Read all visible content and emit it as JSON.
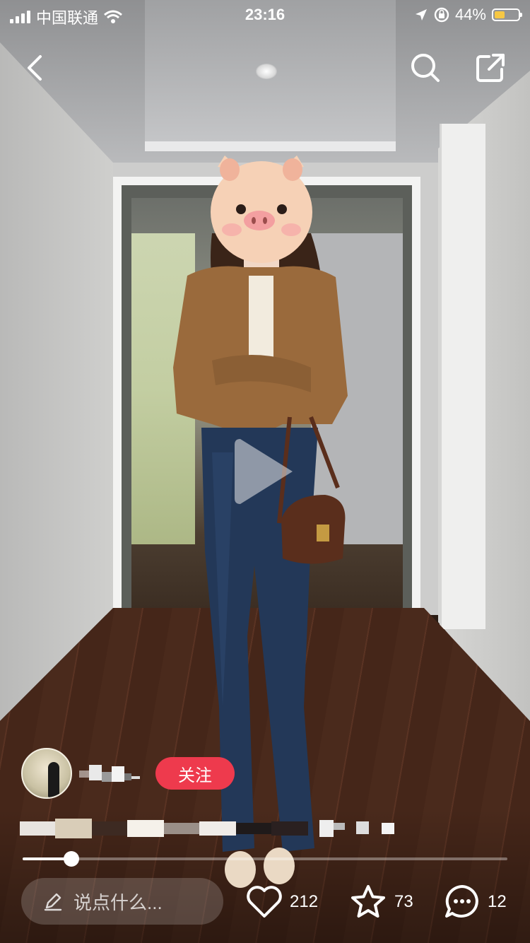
{
  "status_bar": {
    "carrier": "中国联通",
    "time": "23:16",
    "battery_percent": "44%",
    "battery_level": 0.44
  },
  "author": {
    "follow_label": "关注"
  },
  "video": {
    "progress": 0.1
  },
  "bottom_bar": {
    "comment_placeholder": "说点什么...",
    "likes": "212",
    "favorites": "73",
    "comments": "12"
  },
  "colors": {
    "follow_button": "#ee3a4d",
    "battery_fill": "#f6c744"
  }
}
